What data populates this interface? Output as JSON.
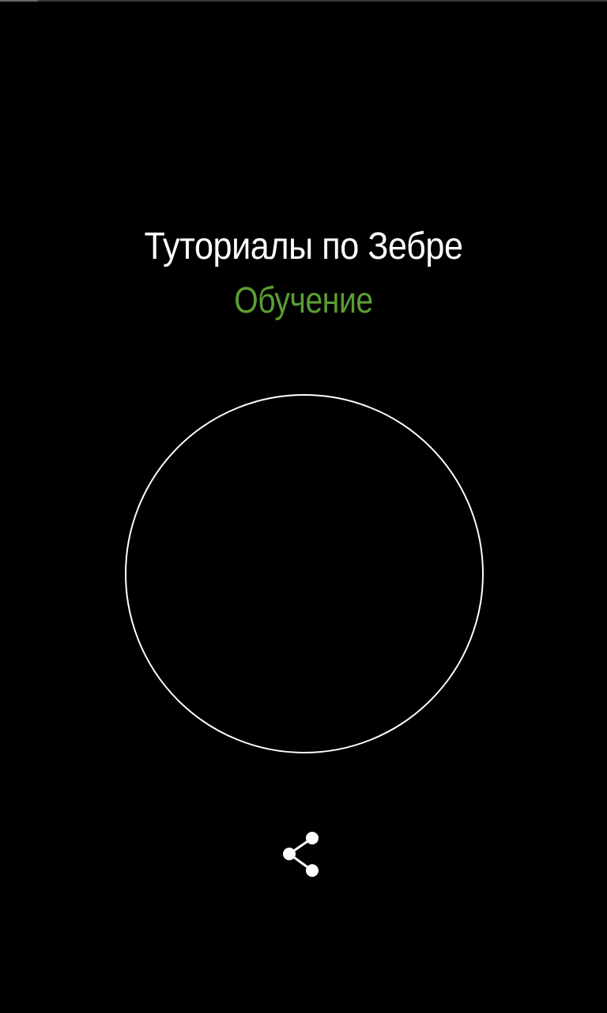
{
  "screen": {
    "title": "Туториалы по Зебре",
    "subtitle": "Обучение",
    "accent_color": "#5a9e34",
    "text_color": "#ffffff",
    "background_color": "#000000"
  },
  "controls": {
    "main_button": {
      "icon": "circle-ring"
    },
    "share": {
      "icon": "share-icon"
    }
  }
}
